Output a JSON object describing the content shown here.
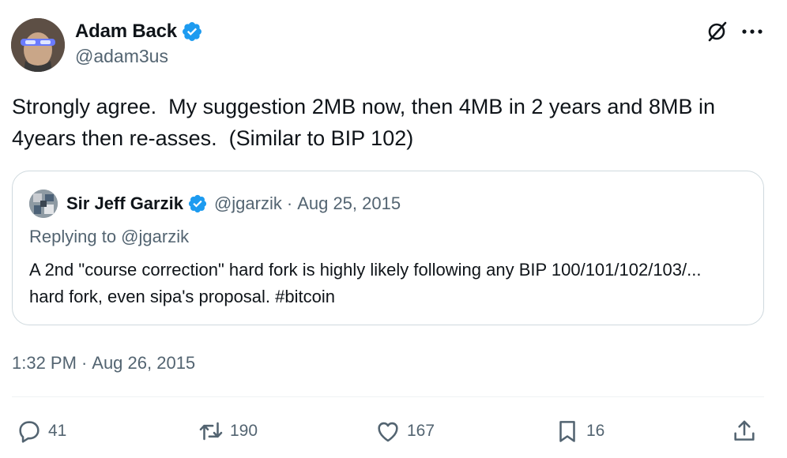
{
  "author": {
    "name": "Adam Back",
    "handle": "@adam3us",
    "verified_color": "#1d9bf0"
  },
  "tweet": {
    "text": "Strongly agree.  My suggestion 2MB now, then 4MB in 2 years and 8MB in 4years then re-asses.  (Similar to BIP 102)",
    "time": "1:32 PM",
    "date": "Aug 26, 2015",
    "separator": "·"
  },
  "quoted": {
    "name": "Sir Jeff Garzik",
    "handle": "@jgarzik",
    "separator": "·",
    "date": "Aug 25, 2015",
    "replying_to": "Replying to @jgarzik",
    "text": "A 2nd \"course correction\" hard fork is highly likely following any BIP 100/101/102/103/... hard fork, even sipa's proposal. #bitcoin"
  },
  "actions": {
    "replies": "41",
    "reposts": "190",
    "likes": "167",
    "bookmarks": "16"
  },
  "icons": {
    "header": [
      "grok-icon",
      "more-icon"
    ],
    "actions": [
      "reply-icon",
      "repost-icon",
      "like-icon",
      "bookmark-icon",
      "share-icon"
    ]
  },
  "colors": {
    "text": "#0f1419",
    "secondary": "#536471",
    "border": "#cfd9de"
  }
}
